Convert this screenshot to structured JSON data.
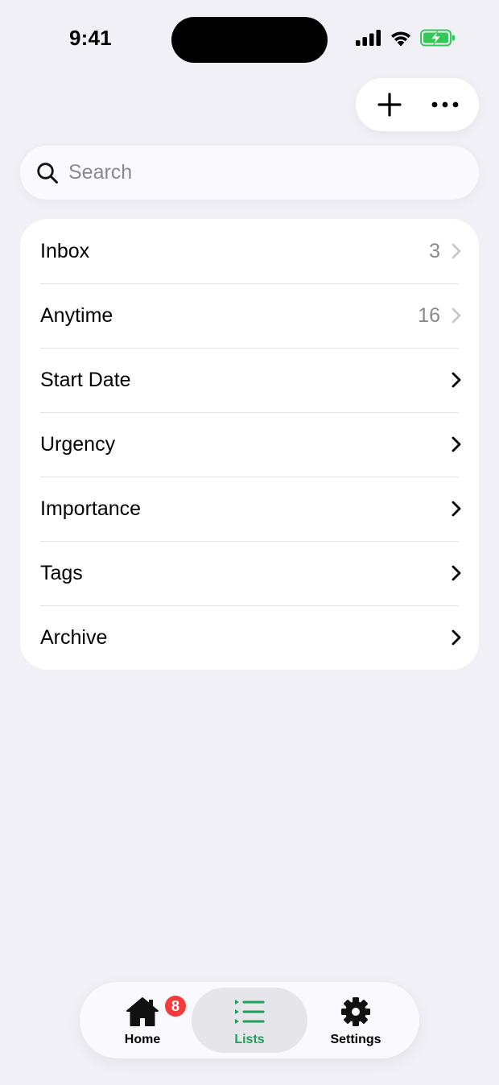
{
  "status_bar": {
    "time": "9:41"
  },
  "toolbar": {
    "add_icon": "plus-icon",
    "more_icon": "ellipsis-icon"
  },
  "search": {
    "placeholder": "Search",
    "value": "",
    "icon": "magnifier-icon"
  },
  "list": {
    "items": [
      {
        "label": "Inbox",
        "count": "3"
      },
      {
        "label": "Anytime",
        "count": "16"
      },
      {
        "label": "Start Date",
        "count": ""
      },
      {
        "label": "Urgency",
        "count": ""
      },
      {
        "label": "Importance",
        "count": ""
      },
      {
        "label": "Tags",
        "count": ""
      },
      {
        "label": "Archive",
        "count": ""
      }
    ]
  },
  "tab_bar": {
    "home": {
      "label": "Home",
      "badge": "8",
      "icon": "house-icon"
    },
    "lists": {
      "label": "Lists",
      "icon": "list-icon",
      "selected": true
    },
    "settings": {
      "label": "Settings",
      "icon": "gear-icon"
    }
  },
  "colors": {
    "background": "#F1F0F6",
    "accent": "#1F9E5A",
    "badge": "#F43B3B",
    "battery": "#34C759"
  }
}
